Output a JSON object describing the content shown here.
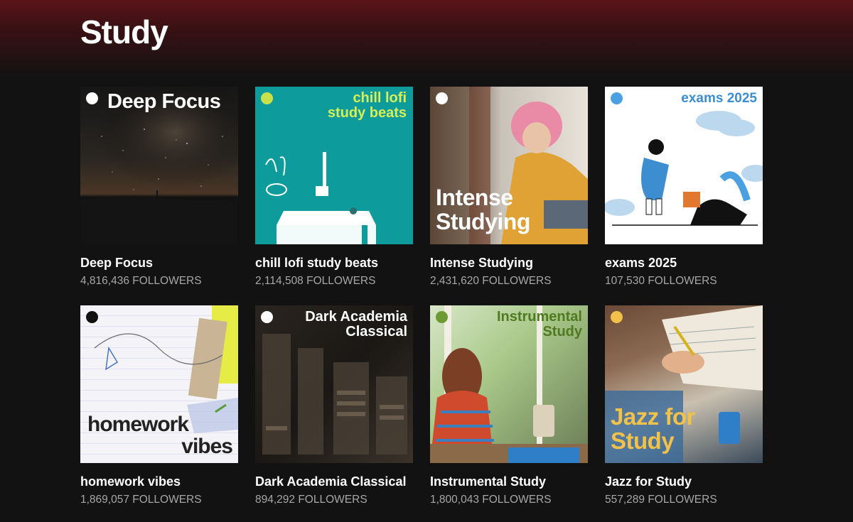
{
  "page": {
    "title": "Study"
  },
  "colors": {
    "background": "#121212",
    "hero": "#5a1419",
    "subtext": "#a7a7a7"
  },
  "playlists": [
    {
      "title": "Deep Focus",
      "followers": "4,816,436 FOLLOWERS",
      "cover_text": "Deep Focus",
      "icon": "spotify-icon"
    },
    {
      "title": "chill lofi study beats",
      "followers": "2,114,508 FOLLOWERS",
      "cover_text_1": "chill lofi",
      "cover_text_2": "study beats",
      "icon": "spotify-icon"
    },
    {
      "title": "Intense Studying",
      "followers": "2,431,620 FOLLOWERS",
      "cover_text_1": "Intense",
      "cover_text_2": "Studying",
      "icon": "spotify-icon"
    },
    {
      "title": "exams 2025",
      "followers": "107,530 FOLLOWERS",
      "cover_text": "exams 2025",
      "icon": "spotify-icon"
    },
    {
      "title": "homework vibes",
      "followers": "1,869,057 FOLLOWERS",
      "cover_text_1": "homework",
      "cover_text_2": "vibes",
      "icon": "spotify-icon"
    },
    {
      "title": "Dark Academia Classical",
      "followers": "894,292 FOLLOWERS",
      "cover_text_1": "Dark Academia",
      "cover_text_2": "Classical",
      "icon": "spotify-icon"
    },
    {
      "title": "Instrumental Study",
      "followers": "1,800,043 FOLLOWERS",
      "cover_text_1": "Instrumental",
      "cover_text_2": "Study",
      "icon": "spotify-icon"
    },
    {
      "title": "Jazz for Study",
      "followers": "557,289 FOLLOWERS",
      "cover_text_1": "Jazz for",
      "cover_text_2": "Study",
      "icon": "spotify-icon"
    }
  ]
}
